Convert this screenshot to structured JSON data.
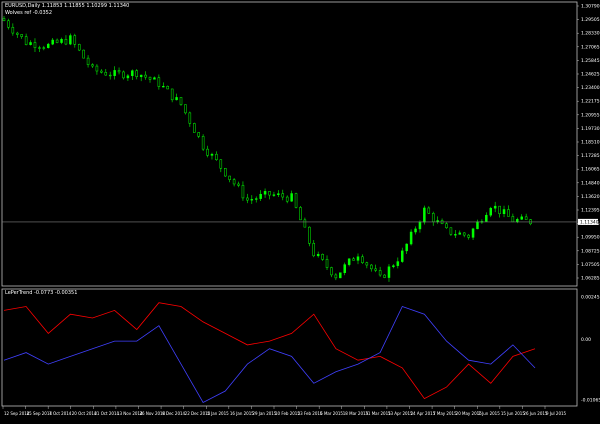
{
  "main_panel": {
    "symbol_header": "EURUSD,Daily 1.11853 1.11855 1.10299 1.11340",
    "indicator_header": "Wolves ref -0.0352"
  },
  "sub_panel": {
    "indicator_header": "LePerTrend -0.0773 -0.00351"
  },
  "price_axis": {
    "labels": [
      "1.30790",
      "1.29505",
      "1.28330",
      "1.27065",
      "1.25845",
      "1.24625",
      "1.23400",
      "1.22175",
      "1.20955",
      "1.19730",
      "1.18510",
      "1.17285",
      "1.16065",
      "1.14840",
      "1.13620",
      "1.12395",
      "1.11175",
      "1.09950",
      "1.08725",
      "1.07505",
      "1.06285"
    ],
    "current_price": "1.11340"
  },
  "sub_axis": {
    "labels": [
      "0.00245",
      "0.00",
      "-0.01065"
    ]
  },
  "time_axis": {
    "labels": [
      "12 Sep 2014",
      "25 Sep 2014",
      "7 Oct 2014",
      "20 Oct 2014",
      "31 Oct 2014",
      "13 Nov 2014",
      "26 Nov 2014",
      "9 Dec 2014",
      "22 Dec 2014",
      "5 Jan 2015",
      "16 Jan 2015",
      "29 Jan 2015",
      "10 Feb 2015",
      "23 Feb 2015",
      "6 Mar 2015",
      "18 Mar 2015",
      "31 Mar 2015",
      "13 Apr 2015",
      "24 Apr 2015",
      "7 May 2015",
      "20 May 2015",
      "2 Jun 2015",
      "15 Jun 2015",
      "26 Jun 2015",
      "9 Jul 2015"
    ]
  },
  "colors": {
    "background": "#000000",
    "candles": "#00ff00",
    "line_red": "#ff0000",
    "line_blue": "#4040ff",
    "axis": "#c0c0c0",
    "text": "#ffffff"
  },
  "chart_data": [
    {
      "type": "candlestick",
      "title": "EURUSD,Daily 1.11853 1.11855 1.10299 1.11340",
      "ylim": [
        1.0575,
        1.3095
      ],
      "x": [
        "12 Sep 2014",
        "25 Sep 2014",
        "7 Oct 2014",
        "20 Oct 2014",
        "31 Oct 2014",
        "13 Nov 2014",
        "26 Nov 2014",
        "9 Dec 2014",
        "22 Dec 2014",
        "5 Jan 2015",
        "16 Jan 2015",
        "29 Jan 2015",
        "10 Feb 2015",
        "23 Feb 2015",
        "6 Mar 2015",
        "18 Mar 2015",
        "31 Mar 2015",
        "13 Apr 2015",
        "24 Apr 2015",
        "7 May 2015",
        "20 May 2015",
        "2 Jun 2015",
        "15 Jun 2015",
        "26 Jun 2015",
        "9 Jul 2015"
      ],
      "close": [
        1.2945,
        1.275,
        1.272,
        1.278,
        1.25,
        1.246,
        1.248,
        1.238,
        1.219,
        1.182,
        1.158,
        1.133,
        1.138,
        1.135,
        1.085,
        1.065,
        1.085,
        1.062,
        1.085,
        1.124,
        1.105,
        1.101,
        1.129,
        1.115,
        1.1134
      ],
      "current_price": 1.1134,
      "grid": false
    },
    {
      "type": "line",
      "title": "LePerTrend -0.0773 -0.00351",
      "ylim": [
        -0.0112,
        0.003
      ],
      "x": [
        "12 Sep 2014",
        "25 Sep 2014",
        "7 Oct 2014",
        "20 Oct 2014",
        "31 Oct 2014",
        "13 Nov 2014",
        "26 Nov 2014",
        "9 Dec 2014",
        "22 Dec 2014",
        "5 Jan 2015",
        "16 Jan 2015",
        "29 Jan 2015",
        "10 Feb 2015",
        "23 Feb 2015",
        "6 Mar 2015",
        "18 Mar 2015",
        "31 Mar 2015",
        "13 Apr 2015",
        "24 Apr 2015",
        "7 May 2015",
        "20 May 2015",
        "2 Jun 2015",
        "15 Jun 2015",
        "26 Jun 2015",
        "9 Jul 2015"
      ],
      "series": [
        {
          "color": "#ff0000",
          "values": [
            0.001,
            0.0015,
            -0.002,
            0.0005,
            0.0,
            0.001,
            -0.0015,
            0.002,
            0.0015,
            -0.0005,
            -0.002,
            -0.0035,
            -0.003,
            -0.002,
            0.0005,
            -0.004,
            -0.0055,
            -0.005,
            -0.0065,
            -0.0105,
            -0.009,
            -0.006,
            -0.0085,
            -0.005,
            -0.004
          ]
        },
        {
          "color": "#4040ff",
          "values": [
            -0.0055,
            -0.0045,
            -0.006,
            -0.005,
            -0.004,
            -0.003,
            -0.003,
            -0.001,
            -0.006,
            -0.011,
            -0.0095,
            -0.006,
            -0.004,
            -0.005,
            -0.0085,
            -0.007,
            -0.006,
            -0.0045,
            0.0015,
            0.0005,
            -0.003,
            -0.0055,
            -0.006,
            -0.0035,
            -0.0065
          ]
        }
      ],
      "grid": false
    }
  ]
}
